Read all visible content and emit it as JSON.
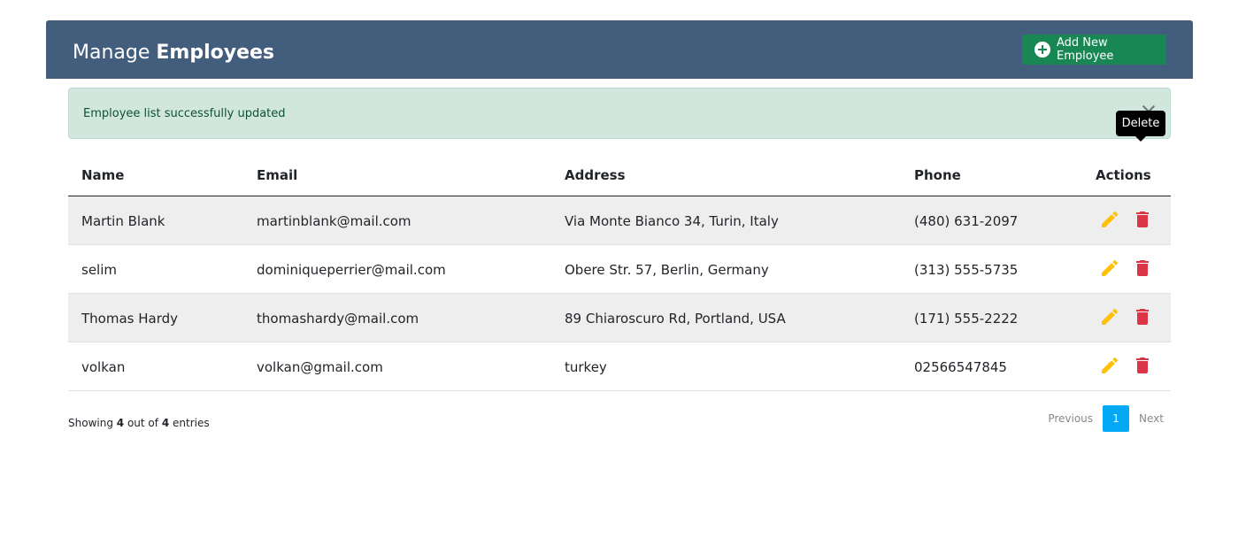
{
  "header": {
    "title_part1": "Manage",
    "title_part2": "Employees",
    "add_button_label": "Add New Employee"
  },
  "alert": {
    "message": "Employee list successfully updated"
  },
  "tooltip": {
    "text": "Delete"
  },
  "table": {
    "columns": [
      "Name",
      "Email",
      "Address",
      "Phone",
      "Actions"
    ],
    "rows": [
      {
        "name": "Martin Blank",
        "email": "martinblank@mail.com",
        "address": "Via Monte Bianco 34, Turin, Italy",
        "phone": "(480) 631-2097"
      },
      {
        "name": "selim",
        "email": "dominiqueperrier@mail.com",
        "address": "Obere Str. 57, Berlin, Germany",
        "phone": "(313) 555-5735"
      },
      {
        "name": "Thomas Hardy",
        "email": "thomashardy@mail.com",
        "address": "89 Chiaroscuro Rd, Portland, USA",
        "phone": "(171) 555-2222"
      },
      {
        "name": "volkan",
        "email": "volkan@gmail.com",
        "address": "turkey",
        "phone": "02566547845"
      }
    ]
  },
  "footer": {
    "showing_prefix": "Showing",
    "showing_count": "4",
    "showing_mid": "out of",
    "showing_total": "4",
    "showing_suffix": "entries",
    "pagination": {
      "previous": "Previous",
      "current_page": "1",
      "next": "Next"
    }
  },
  "colors": {
    "header_bg": "#435d7d",
    "add_button_bg": "#198754",
    "alert_bg": "#d1e7dd",
    "edit_icon": "#ffc107",
    "delete_icon": "#dc3545",
    "pagination_active": "#03a9f4"
  },
  "icons": {
    "add": "plus-circle-icon",
    "edit": "pencil-icon",
    "delete": "trash-icon",
    "close": "close-icon"
  }
}
